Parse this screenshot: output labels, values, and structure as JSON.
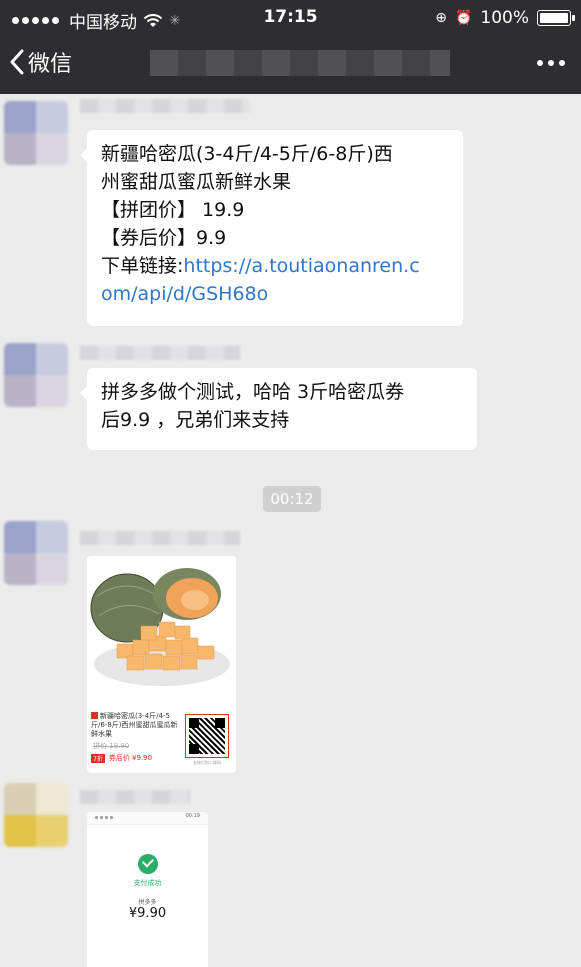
{
  "statusbar": {
    "carrier": "中国移动",
    "time": "17:15",
    "battery": "100%",
    "battery_level": 1.0
  },
  "navbar": {
    "back_label": "微信"
  },
  "messages": {
    "msg1": {
      "line1": "新疆哈密瓜(3-4斤/4-5斤/6-8斤)西",
      "line2": "州蜜甜瓜蜜瓜新鲜水果",
      "line3": "【拼团价】 19.9",
      "line4": "【券后价】9.9",
      "line5_prefix": "下单链接:",
      "line5_link": "https://a.toutiaonanren.c",
      "line6_link": "om/api/d/GSH68o"
    },
    "msg2": {
      "line1": "拼多多做个测试，哈哈 3斤哈密瓜券",
      "line2": "后9.9 ，兄弟们来支持"
    },
    "timestamp": "00:12",
    "card1": {
      "title": "新疆哈密瓜(3-4斤/4-5斤/6-8斤)西州蜜甜瓜蜜瓜新鲜水果",
      "original_price": "拼价 19.90",
      "tag": "7折",
      "coupon_price": "券后价 ¥9.90",
      "qr_caption": "长按识别二维码"
    },
    "card2": {
      "time": "00:19",
      "status": "支付成功",
      "merchant": "拼多多",
      "amount": "¥9.90"
    }
  },
  "colors": {
    "bar_bg": "#2e2e30",
    "chat_bg": "#ebebeb",
    "link": "#2e77c9",
    "pdd_red": "#e02e24",
    "wechat_green": "#2aae67"
  }
}
